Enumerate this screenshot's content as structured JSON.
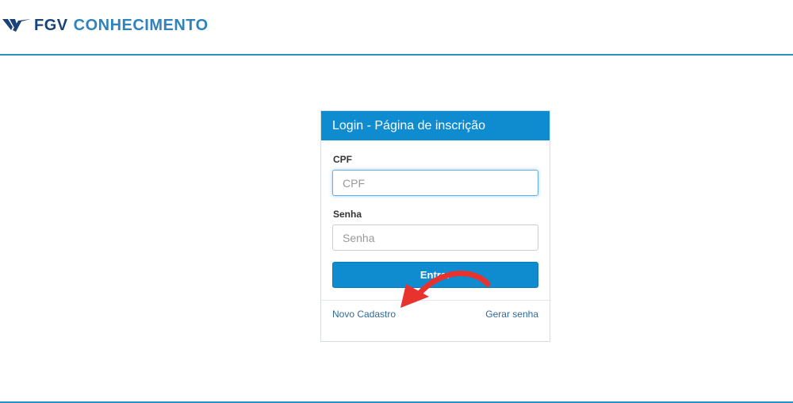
{
  "brand": {
    "logo_icon": "fgv-chevron-logo",
    "name_part1": "FGV",
    "name_part2": "CONHECIMENTO",
    "primary_color": "#17437a",
    "accent_color": "#2e83bd"
  },
  "login": {
    "heading": "Login - Página de inscrição",
    "cpf": {
      "label": "CPF",
      "placeholder": "CPF",
      "value": ""
    },
    "senha": {
      "label": "Senha",
      "placeholder": "Senha",
      "value": ""
    },
    "submit_label": "Entrar",
    "links": {
      "register": "Novo Cadastro",
      "generate_password": "Gerar senha"
    },
    "button_color": "#0f8bd0"
  },
  "annotation": {
    "icon": "red-curved-arrow-icon",
    "color": "#e8322e"
  }
}
